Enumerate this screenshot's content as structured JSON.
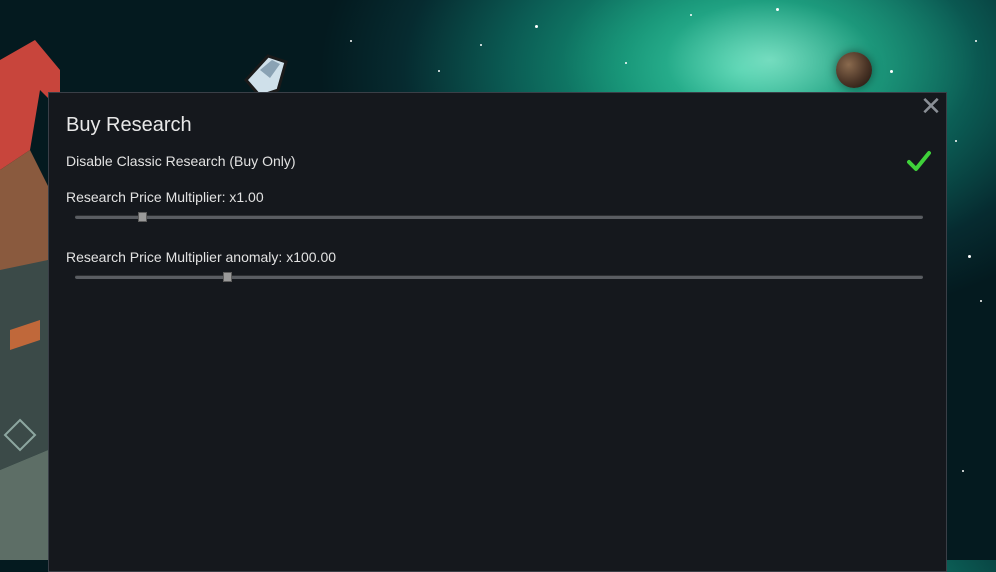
{
  "window": {
    "title": "Buy Research"
  },
  "settings": {
    "disable_classic": {
      "label": "Disable Classic Research (Buy Only)",
      "checked": true
    },
    "price_multiplier": {
      "label": "Research Price Multiplier: x1.00",
      "fraction": 0.08
    },
    "anomaly_multiplier": {
      "label": "Research Price Multiplier anomaly: x100.00",
      "fraction": 0.18
    }
  },
  "icons": {
    "close": "close-icon",
    "check": "checkmark-icon"
  },
  "colors": {
    "check": "#3fd13a",
    "panel_bg": "#15181d"
  }
}
